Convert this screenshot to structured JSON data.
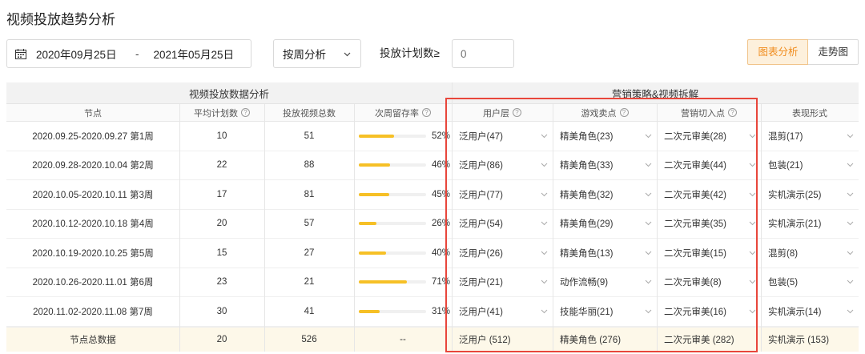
{
  "page": {
    "title": "视频投放趋势分析"
  },
  "toolbar": {
    "date_start": "2020年09月25日",
    "date_sep": "-",
    "date_end": "2021年05月25日",
    "period": "按周分析",
    "count_label": "投放计划数≥",
    "count_placeholder": "0",
    "view_chart": "图表分析",
    "view_trend": "走势图",
    "icons": {
      "calendar": "calendar-icon",
      "chevron": "chevron-down-icon"
    }
  },
  "colors": {
    "accent": "#f08c1e",
    "bar": "#f6c026",
    "highlight": "#e8463b",
    "total_bg": "#fdf8e9"
  },
  "table": {
    "groups": {
      "left": "视频投放数据分析",
      "right": "营销策略&视频拆解"
    },
    "columns": [
      "节点",
      "平均计划数",
      "投放视频总数",
      "次周留存率",
      "用户层",
      "游戏卖点",
      "营销切入点",
      "表现形式"
    ],
    "rows": [
      {
        "node": "2020.09.25-2020.09.27 第1周",
        "avg": "10",
        "videos": "51",
        "retention_pct": 52,
        "retention": "52%",
        "user": "泛用户(47)",
        "selling": "精美角色(23)",
        "entry": "二次元审美(28)",
        "form": "混剪(17)"
      },
      {
        "node": "2020.09.28-2020.10.04 第2周",
        "avg": "22",
        "videos": "88",
        "retention_pct": 46,
        "retention": "46%",
        "user": "泛用户(86)",
        "selling": "精美角色(33)",
        "entry": "二次元审美(44)",
        "form": "包装(21)"
      },
      {
        "node": "2020.10.05-2020.10.11 第3周",
        "avg": "17",
        "videos": "81",
        "retention_pct": 45,
        "retention": "45%",
        "user": "泛用户(77)",
        "selling": "精美角色(32)",
        "entry": "二次元审美(42)",
        "form": "实机演示(25)"
      },
      {
        "node": "2020.10.12-2020.10.18 第4周",
        "avg": "20",
        "videos": "57",
        "retention_pct": 26,
        "retention": "26%",
        "user": "泛用户(54)",
        "selling": "精美角色(29)",
        "entry": "二次元审美(35)",
        "form": "实机演示(21)"
      },
      {
        "node": "2020.10.19-2020.10.25 第5周",
        "avg": "15",
        "videos": "27",
        "retention_pct": 40,
        "retention": "40%",
        "user": "泛用户(26)",
        "selling": "精美角色(13)",
        "entry": "二次元审美(15)",
        "form": "混剪(8)"
      },
      {
        "node": "2020.10.26-2020.11.01 第6周",
        "avg": "23",
        "videos": "21",
        "retention_pct": 71,
        "retention": "71%",
        "user": "泛用户(21)",
        "selling": "动作流畅(9)",
        "entry": "二次元审美(8)",
        "form": "包装(5)"
      },
      {
        "node": "2020.11.02-2020.11.08 第7周",
        "avg": "30",
        "videos": "41",
        "retention_pct": 31,
        "retention": "31%",
        "user": "泛用户(41)",
        "selling": "技能华丽(21)",
        "entry": "二次元审美(16)",
        "form": "实机演示(14)"
      }
    ],
    "total": {
      "node": "节点总数据",
      "avg": "20",
      "videos": "526",
      "retention": "--",
      "user": "泛用户 (512)",
      "selling": "精美角色 (276)",
      "entry": "二次元审美 (282)",
      "form": "实机演示 (153)"
    }
  }
}
